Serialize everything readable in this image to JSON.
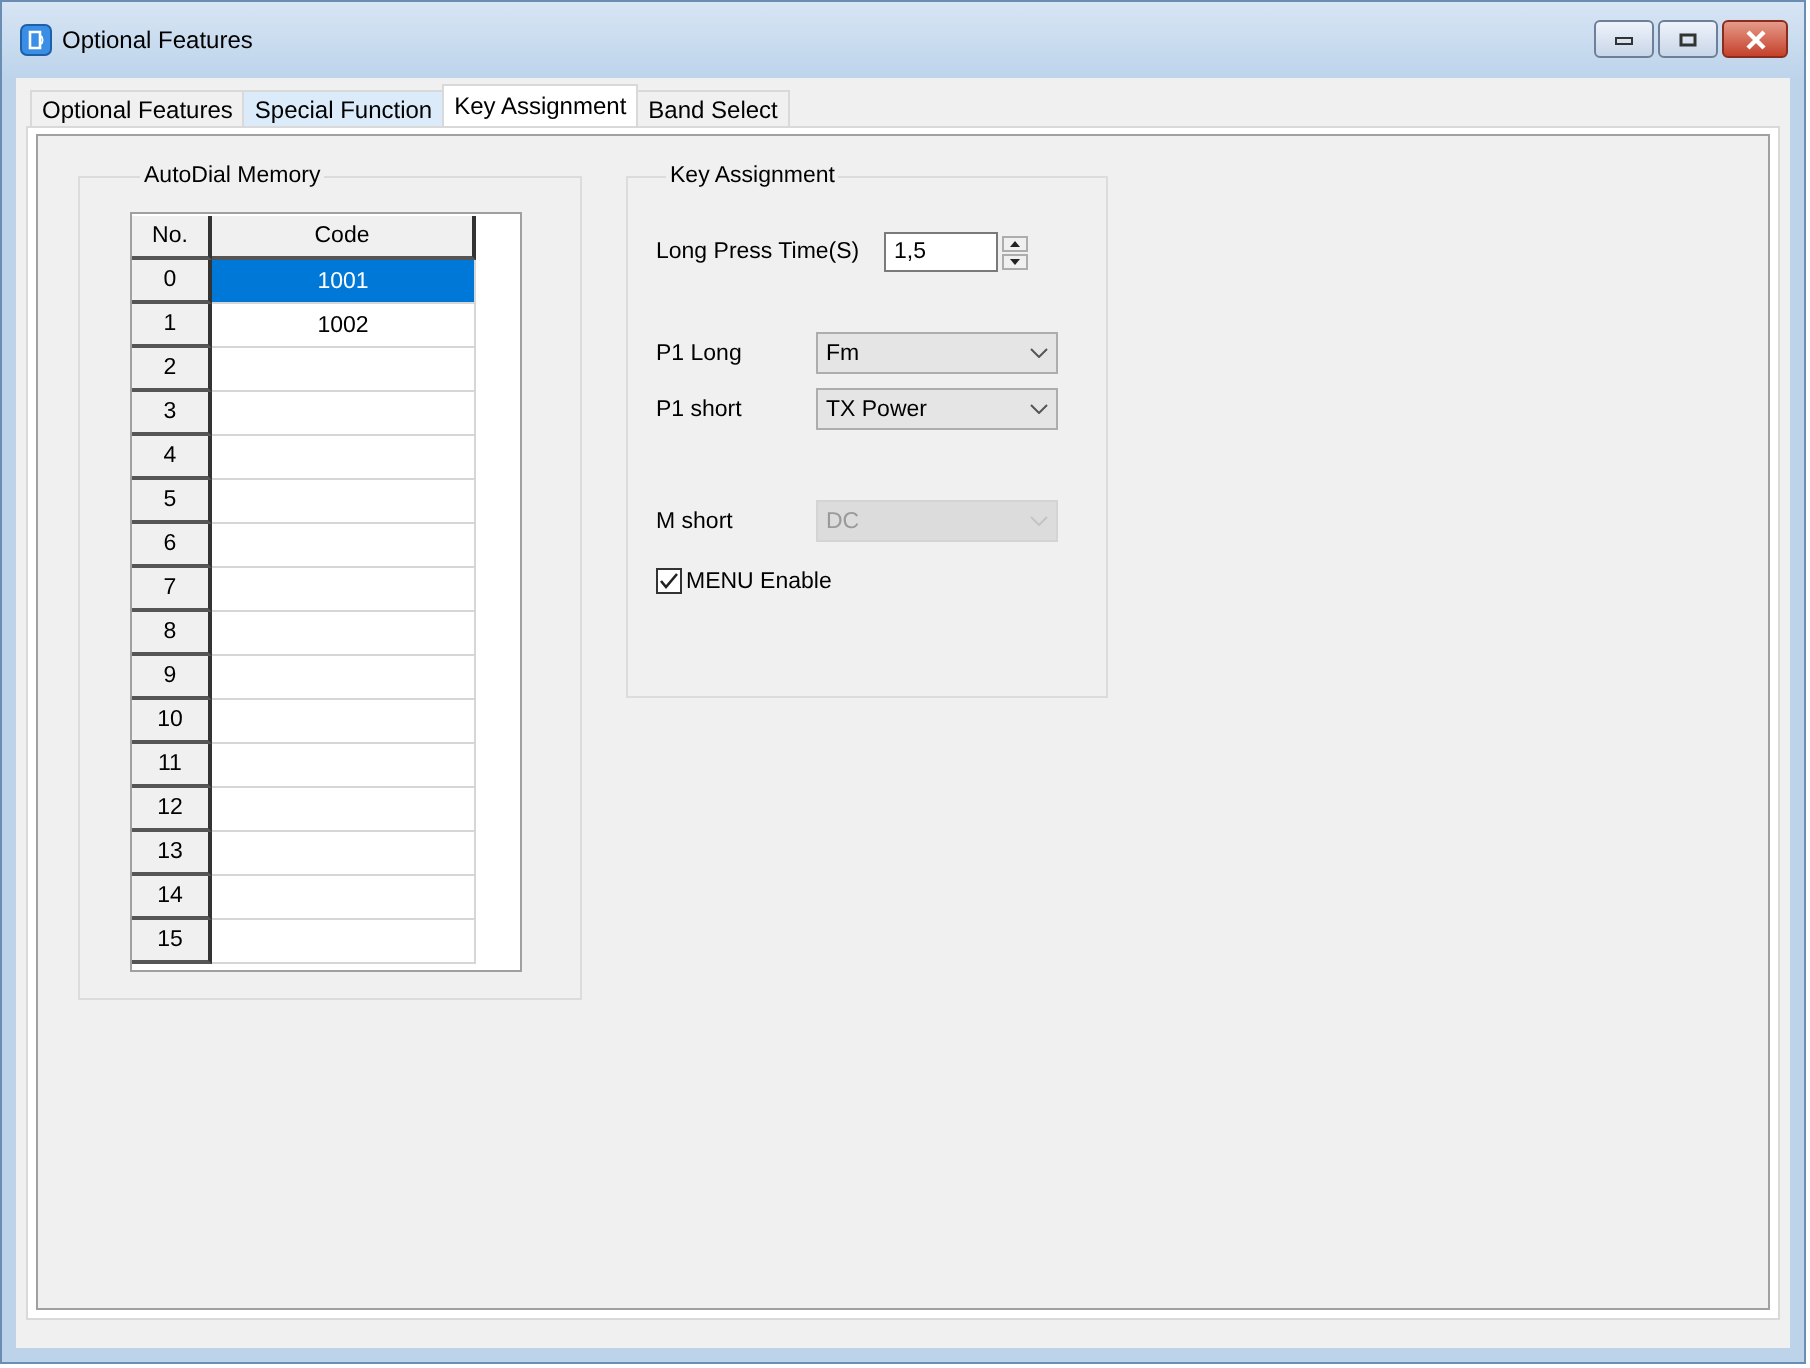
{
  "window": {
    "title": "Optional Features"
  },
  "tabs": [
    {
      "label": "Optional Features",
      "selected": false
    },
    {
      "label": "Special Function",
      "selected": false
    },
    {
      "label": "Key Assignment",
      "selected": true
    },
    {
      "label": "Band Select",
      "selected": false
    }
  ],
  "autodial_memory": {
    "title": "AutoDial Memory",
    "columns": [
      "No.",
      "Code"
    ],
    "rows": [
      {
        "no": "0",
        "code": "1001",
        "selected": true
      },
      {
        "no": "1",
        "code": "1002",
        "selected": false
      },
      {
        "no": "2",
        "code": "",
        "selected": false
      },
      {
        "no": "3",
        "code": "",
        "selected": false
      },
      {
        "no": "4",
        "code": "",
        "selected": false
      },
      {
        "no": "5",
        "code": "",
        "selected": false
      },
      {
        "no": "6",
        "code": "",
        "selected": false
      },
      {
        "no": "7",
        "code": "",
        "selected": false
      },
      {
        "no": "8",
        "code": "",
        "selected": false
      },
      {
        "no": "9",
        "code": "",
        "selected": false
      },
      {
        "no": "10",
        "code": "",
        "selected": false
      },
      {
        "no": "11",
        "code": "",
        "selected": false
      },
      {
        "no": "12",
        "code": "",
        "selected": false
      },
      {
        "no": "13",
        "code": "",
        "selected": false
      },
      {
        "no": "14",
        "code": "",
        "selected": false
      },
      {
        "no": "15",
        "code": "",
        "selected": false
      }
    ]
  },
  "key_assignment": {
    "title": "Key Assignment",
    "long_press": {
      "label": "Long Press Time(S)",
      "value": "1,5"
    },
    "keys": [
      {
        "label": "P1 Long",
        "value": "Fm",
        "disabled": false
      },
      {
        "label": "P1 short",
        "value": "TX Power",
        "disabled": false
      },
      {
        "label": "M short",
        "value": "DC",
        "disabled": true
      }
    ],
    "menu_enable": {
      "label": "MENU Enable",
      "checked": true
    }
  }
}
